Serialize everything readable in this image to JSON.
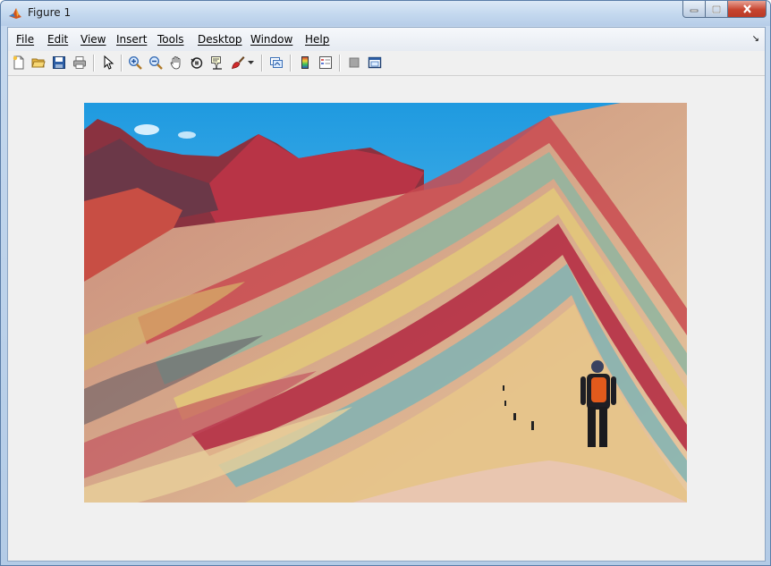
{
  "window": {
    "title": "Figure 1",
    "app_icon": "matlab-icon"
  },
  "menu": {
    "items": [
      "File",
      "Edit",
      "View",
      "Insert",
      "Tools",
      "Desktop",
      "Window",
      "Help"
    ],
    "corner_icon": "dock-arrow-icon"
  },
  "toolbar": {
    "buttons": [
      "new-figure-icon",
      "open-file-icon",
      "save-icon",
      "print-icon",
      "edit-plot-arrow-icon",
      "zoom-in-icon",
      "zoom-out-icon",
      "pan-hand-icon",
      "rotate-3d-icon",
      "data-cursor-icon",
      "brush-icon",
      "brush-dropdown-icon",
      "link-plot-icon",
      "insert-colorbar-icon",
      "insert-legend-icon",
      "hide-plot-tools-icon",
      "show-plot-tools-icon"
    ]
  },
  "colors": {
    "titlebar": "#c5d9ef",
    "close_button": "#c7442f",
    "client_bg": "#f0f0f0"
  },
  "figure": {
    "content": "photo-rainbow-mountain"
  }
}
